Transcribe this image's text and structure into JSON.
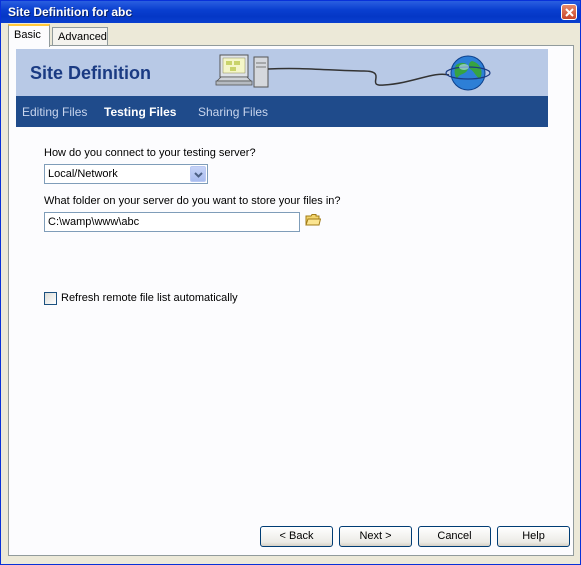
{
  "window": {
    "title": "Site Definition for abc"
  },
  "tabs": [
    {
      "label": "Basic",
      "active": true
    },
    {
      "label": "Advanced",
      "active": false
    }
  ],
  "banner": {
    "title": "Site Definition"
  },
  "subnav": [
    {
      "label": "Editing Files",
      "active": false
    },
    {
      "label": "Testing Files",
      "active": true
    },
    {
      "label": "Sharing Files",
      "active": false
    }
  ],
  "form": {
    "connect_question": "How do you connect to your testing server?",
    "connect_value": "Local/Network",
    "folder_question": "What folder on your server do you want to store your files in?",
    "folder_value": "C:\\wamp\\www\\abc",
    "refresh_label": "Refresh remote file list automatically",
    "refresh_checked": false
  },
  "buttons": {
    "back": "< Back",
    "next": "Next >",
    "cancel": "Cancel",
    "help": "Help"
  },
  "colors": {
    "titlebar": "#0a3fd0",
    "banner_bg": "#b8c9e6",
    "banner_title": "#1b3b83",
    "subnav_bg": "#1f4b8b",
    "window_bg": "#ece9d8"
  },
  "icons": {
    "close": "close-icon",
    "dropdown": "chevron-down-icon",
    "folder": "folder-icon",
    "banner_art": "network-computer-globe-illustration"
  }
}
